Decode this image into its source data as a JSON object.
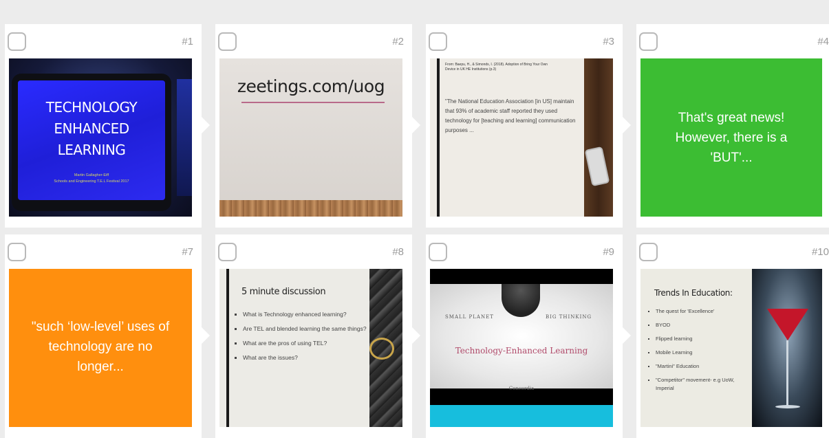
{
  "slides": [
    {
      "number": "#1",
      "kind": "image",
      "title_lines": [
        "TECHNOLOGY",
        "ENHANCED",
        "LEARNING"
      ],
      "subtitle_lines": [
        "Martin Gallagher-Eiff",
        "Schools and Engineering T.E.L Festival 2017"
      ]
    },
    {
      "number": "#2",
      "kind": "image",
      "title": "zeetings.com/uog"
    },
    {
      "number": "#3",
      "kind": "image",
      "reference": "From: Baepu, H., & Simonds, I. (2018). Adoption of Bring Your Own Device in UK HE Institutions (p.3)",
      "quote": "\"The National Education Association [in US] maintain that 93% of academic staff reported they used technology for [teaching and learning] communication purposes ..."
    },
    {
      "number": "#4",
      "kind": "text",
      "text": "That's great news! However, there is a 'BUT'...",
      "color": "#3cbd33"
    },
    {
      "number": "#7",
      "kind": "text",
      "text": "\"such ‘low-level’ uses of technology are no longer...",
      "color": "#ff8f0e"
    },
    {
      "number": "#8",
      "kind": "image",
      "title": "5 minute discussion",
      "bullets": [
        "What is Technology enhanced learning?",
        "Are TEL and blended learning the same things?",
        "What are the pros of using TEL?",
        "What are the issues?"
      ]
    },
    {
      "number": "#9",
      "kind": "image",
      "left_tag": "SMALL PLANET",
      "right_tag": "BIG THINKING",
      "title": "Technology-Enhanced Learning",
      "logo": "Concordia"
    },
    {
      "number": "#10",
      "kind": "image",
      "title": "Trends In Education:",
      "bullets": [
        "The quest for 'Excellence'",
        "BYOD",
        "Flipped learning",
        "Mobile Learning",
        "\"Martini\" Education",
        "\"Competitor\" movement- e.g UoW, Imperial"
      ]
    }
  ]
}
